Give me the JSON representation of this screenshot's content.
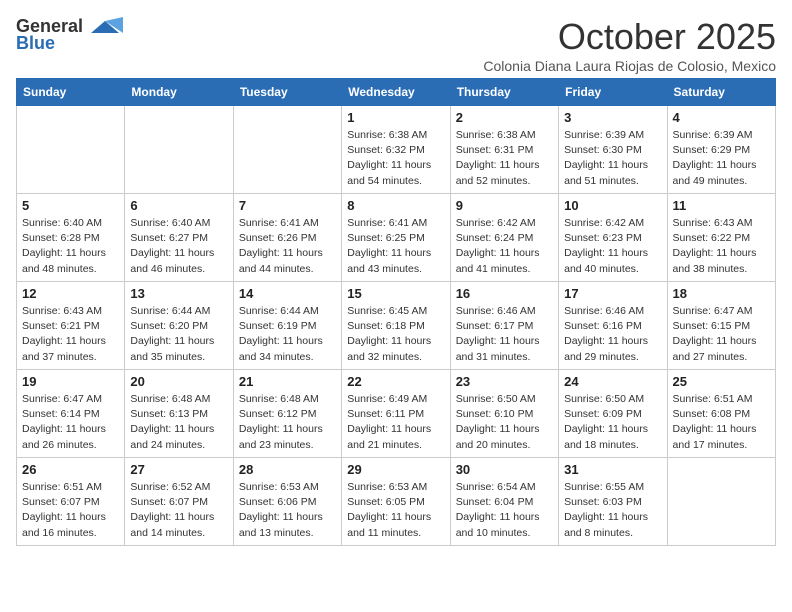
{
  "logo": {
    "general": "General",
    "blue": "Blue"
  },
  "title": "October 2025",
  "location": "Colonia Diana Laura Riojas de Colosio, Mexico",
  "days_of_week": [
    "Sunday",
    "Monday",
    "Tuesday",
    "Wednesday",
    "Thursday",
    "Friday",
    "Saturday"
  ],
  "weeks": [
    [
      {
        "day": "",
        "info": ""
      },
      {
        "day": "",
        "info": ""
      },
      {
        "day": "",
        "info": ""
      },
      {
        "day": "1",
        "info": "Sunrise: 6:38 AM\nSunset: 6:32 PM\nDaylight: 11 hours and 54 minutes."
      },
      {
        "day": "2",
        "info": "Sunrise: 6:38 AM\nSunset: 6:31 PM\nDaylight: 11 hours and 52 minutes."
      },
      {
        "day": "3",
        "info": "Sunrise: 6:39 AM\nSunset: 6:30 PM\nDaylight: 11 hours and 51 minutes."
      },
      {
        "day": "4",
        "info": "Sunrise: 6:39 AM\nSunset: 6:29 PM\nDaylight: 11 hours and 49 minutes."
      }
    ],
    [
      {
        "day": "5",
        "info": "Sunrise: 6:40 AM\nSunset: 6:28 PM\nDaylight: 11 hours and 48 minutes."
      },
      {
        "day": "6",
        "info": "Sunrise: 6:40 AM\nSunset: 6:27 PM\nDaylight: 11 hours and 46 minutes."
      },
      {
        "day": "7",
        "info": "Sunrise: 6:41 AM\nSunset: 6:26 PM\nDaylight: 11 hours and 44 minutes."
      },
      {
        "day": "8",
        "info": "Sunrise: 6:41 AM\nSunset: 6:25 PM\nDaylight: 11 hours and 43 minutes."
      },
      {
        "day": "9",
        "info": "Sunrise: 6:42 AM\nSunset: 6:24 PM\nDaylight: 11 hours and 41 minutes."
      },
      {
        "day": "10",
        "info": "Sunrise: 6:42 AM\nSunset: 6:23 PM\nDaylight: 11 hours and 40 minutes."
      },
      {
        "day": "11",
        "info": "Sunrise: 6:43 AM\nSunset: 6:22 PM\nDaylight: 11 hours and 38 minutes."
      }
    ],
    [
      {
        "day": "12",
        "info": "Sunrise: 6:43 AM\nSunset: 6:21 PM\nDaylight: 11 hours and 37 minutes."
      },
      {
        "day": "13",
        "info": "Sunrise: 6:44 AM\nSunset: 6:20 PM\nDaylight: 11 hours and 35 minutes."
      },
      {
        "day": "14",
        "info": "Sunrise: 6:44 AM\nSunset: 6:19 PM\nDaylight: 11 hours and 34 minutes."
      },
      {
        "day": "15",
        "info": "Sunrise: 6:45 AM\nSunset: 6:18 PM\nDaylight: 11 hours and 32 minutes."
      },
      {
        "day": "16",
        "info": "Sunrise: 6:46 AM\nSunset: 6:17 PM\nDaylight: 11 hours and 31 minutes."
      },
      {
        "day": "17",
        "info": "Sunrise: 6:46 AM\nSunset: 6:16 PM\nDaylight: 11 hours and 29 minutes."
      },
      {
        "day": "18",
        "info": "Sunrise: 6:47 AM\nSunset: 6:15 PM\nDaylight: 11 hours and 27 minutes."
      }
    ],
    [
      {
        "day": "19",
        "info": "Sunrise: 6:47 AM\nSunset: 6:14 PM\nDaylight: 11 hours and 26 minutes."
      },
      {
        "day": "20",
        "info": "Sunrise: 6:48 AM\nSunset: 6:13 PM\nDaylight: 11 hours and 24 minutes."
      },
      {
        "day": "21",
        "info": "Sunrise: 6:48 AM\nSunset: 6:12 PM\nDaylight: 11 hours and 23 minutes."
      },
      {
        "day": "22",
        "info": "Sunrise: 6:49 AM\nSunset: 6:11 PM\nDaylight: 11 hours and 21 minutes."
      },
      {
        "day": "23",
        "info": "Sunrise: 6:50 AM\nSunset: 6:10 PM\nDaylight: 11 hours and 20 minutes."
      },
      {
        "day": "24",
        "info": "Sunrise: 6:50 AM\nSunset: 6:09 PM\nDaylight: 11 hours and 18 minutes."
      },
      {
        "day": "25",
        "info": "Sunrise: 6:51 AM\nSunset: 6:08 PM\nDaylight: 11 hours and 17 minutes."
      }
    ],
    [
      {
        "day": "26",
        "info": "Sunrise: 6:51 AM\nSunset: 6:07 PM\nDaylight: 11 hours and 16 minutes."
      },
      {
        "day": "27",
        "info": "Sunrise: 6:52 AM\nSunset: 6:07 PM\nDaylight: 11 hours and 14 minutes."
      },
      {
        "day": "28",
        "info": "Sunrise: 6:53 AM\nSunset: 6:06 PM\nDaylight: 11 hours and 13 minutes."
      },
      {
        "day": "29",
        "info": "Sunrise: 6:53 AM\nSunset: 6:05 PM\nDaylight: 11 hours and 11 minutes."
      },
      {
        "day": "30",
        "info": "Sunrise: 6:54 AM\nSunset: 6:04 PM\nDaylight: 11 hours and 10 minutes."
      },
      {
        "day": "31",
        "info": "Sunrise: 6:55 AM\nSunset: 6:03 PM\nDaylight: 11 hours and 8 minutes."
      },
      {
        "day": "",
        "info": ""
      }
    ]
  ]
}
